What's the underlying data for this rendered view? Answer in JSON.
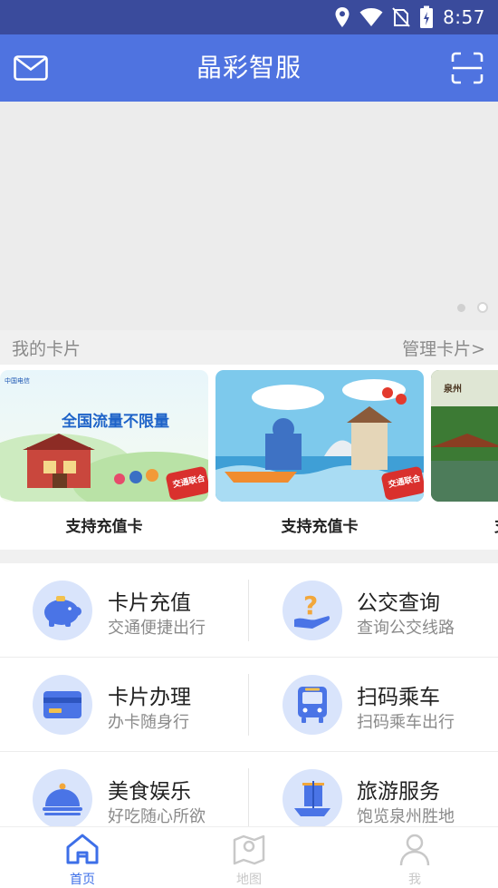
{
  "status_bar": {
    "time": "8:57",
    "icons": [
      "location-icon",
      "wifi-icon",
      "no-sim-icon",
      "battery-charging-icon"
    ]
  },
  "header": {
    "title": "晶彩智服",
    "left_icon": "mail-icon",
    "right_icon": "scan-icon"
  },
  "banner": {
    "dots": 2,
    "active_dot": 2
  },
  "cards_section": {
    "title": "我的卡片",
    "manage_link": "管理卡片>",
    "cards": [
      {
        "label": "支持充值卡",
        "art_text": "全国流量不限量",
        "badge": "交通联合",
        "brand": "中国电信"
      },
      {
        "label": "支持充值卡",
        "badge": "交通联合"
      },
      {
        "label": "支",
        "art_text": "泉州"
      }
    ]
  },
  "menu": {
    "items": [
      {
        "title": "卡片充值",
        "subtitle": "交通便捷出行",
        "icon": "piggy-bank-icon"
      },
      {
        "title": "公交查询",
        "subtitle": "查询公交线路",
        "icon": "question-hand-icon"
      },
      {
        "title": "卡片办理",
        "subtitle": "办卡随身行",
        "icon": "card-icon"
      },
      {
        "title": "扫码乘车",
        "subtitle": "扫码乘车出行",
        "icon": "bus-icon"
      },
      {
        "title": "美食娱乐",
        "subtitle": "好吃随心所欲",
        "icon": "food-cloche-icon"
      },
      {
        "title": "旅游服务",
        "subtitle": "饱览泉州胜地",
        "icon": "sailboat-icon"
      }
    ]
  },
  "tabbar": {
    "tabs": [
      {
        "label": "首页",
        "icon": "home-icon",
        "active": true
      },
      {
        "label": "地图",
        "icon": "map-icon",
        "active": false
      },
      {
        "label": "我",
        "icon": "user-icon",
        "active": false
      }
    ]
  },
  "colors": {
    "status_bar": "#3a4b9c",
    "header": "#4f73e0",
    "accent": "#3d6fe8",
    "inactive_tab": "#c8c8c8"
  }
}
